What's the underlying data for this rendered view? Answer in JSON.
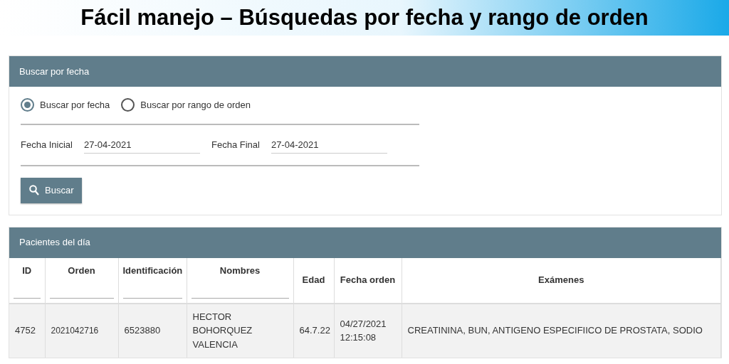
{
  "banner": {
    "title": "Fácil manejo – Búsquedas por fecha y rango de orden"
  },
  "search_panel": {
    "title": "Buscar por fecha",
    "modes": [
      {
        "label": "Buscar por fecha",
        "selected": true
      },
      {
        "label": "Buscar por rango de orden",
        "selected": false
      }
    ],
    "fields": [
      {
        "label": "Fecha Inicial",
        "value": "27-04-2021"
      },
      {
        "label": "Fecha Final",
        "value": "27-04-2021"
      }
    ],
    "button": "Buscar"
  },
  "patients_panel": {
    "title": "Pacientes del día",
    "table": {
      "columns": [
        {
          "label": "ID",
          "filter": true
        },
        {
          "label": "Orden",
          "filter": true
        },
        {
          "label": "Identificación",
          "filter": true
        },
        {
          "label": "Nombres",
          "filter": true
        },
        {
          "label": "Edad",
          "filter": false
        },
        {
          "label": "Fecha orden",
          "filter": false
        },
        {
          "label": "Exámenes",
          "filter": false
        }
      ],
      "rows": [
        [
          "4752",
          "2021042716",
          "6523880",
          "HECTOR BOHORQUEZ VALENCIA",
          "64.7.22",
          "04/27/2021 12:15:08",
          "CREATININA, BUN, ANTIGENO ESPECIFIICO DE PROSTATA, SODIO"
        ]
      ]
    }
  }
}
